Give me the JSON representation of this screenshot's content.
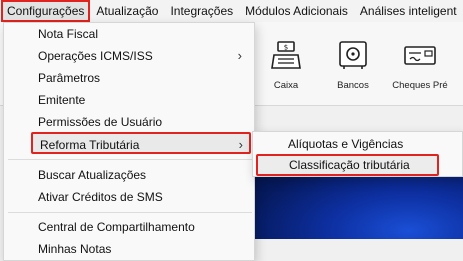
{
  "menubar": {
    "items": [
      "Configurações",
      "Atualização",
      "Integrações",
      "Módulos Adicionais",
      "Análises inteligent"
    ]
  },
  "toolbar": {
    "buttons": [
      {
        "label": "Caixa",
        "icon": "cash-register-icon"
      },
      {
        "label": "Bancos",
        "icon": "safe-icon"
      },
      {
        "label": "Cheques Pré",
        "icon": "check-icon"
      }
    ]
  },
  "dropdown": {
    "items": [
      "Nota Fiscal",
      "Operações ICMS/ISS",
      "Parâmetros",
      "Emitente",
      "Permissões de Usuário",
      "Reforma Tributária",
      "Buscar Atualizações",
      "Ativar Créditos de SMS",
      "Central de Compartilhamento",
      "Minhas Notas"
    ],
    "arrow": "›"
  },
  "submenu": {
    "items": [
      "Alíquotas e Vigências",
      "Classificação tributária"
    ]
  },
  "colors": {
    "highlight_border": "#e0231e",
    "desktop_blue": "#0d2fa0"
  }
}
